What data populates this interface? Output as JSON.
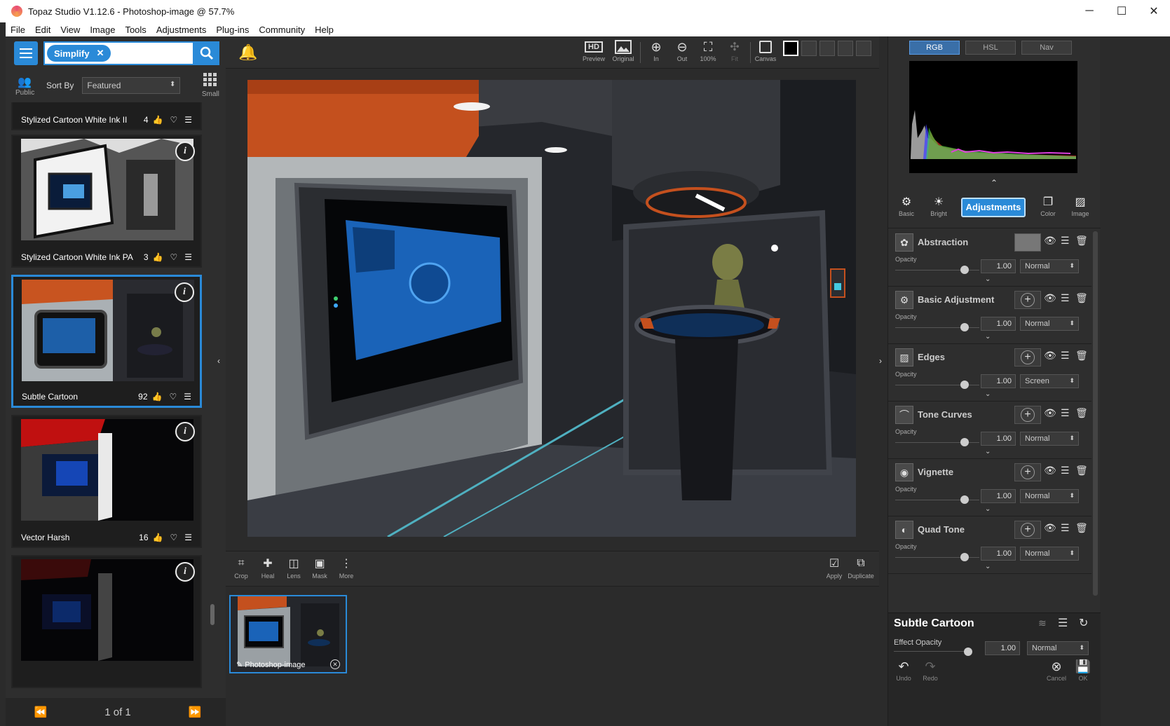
{
  "window": {
    "title": "Topaz Studio V1.12.6 - Photoshop-image @ 57.7%",
    "minimize": "─",
    "maximize": "☐",
    "close": "✕"
  },
  "menu": [
    "File",
    "Edit",
    "View",
    "Image",
    "Tools",
    "Adjustments",
    "Plug-ins",
    "Community",
    "Help"
  ],
  "left": {
    "search_chip": "Simplify",
    "public_label": "Public",
    "sort_by_label": "Sort By",
    "sort_value": "Featured",
    "small_label": "Small",
    "presets": [
      {
        "name": "Stylized Cartoon White Ink II",
        "likes": "4"
      },
      {
        "name": "Stylized Cartoon White Ink PA",
        "likes": "3"
      },
      {
        "name": "Subtle Cartoon",
        "likes": "92"
      },
      {
        "name": "Vector Harsh",
        "likes": "16"
      },
      {
        "name": "",
        "likes": ""
      }
    ],
    "pager": "1 of 1"
  },
  "toolbar": {
    "preview": "Preview",
    "original": "Original",
    "in": "In",
    "out": "Out",
    "zoom100": "100%",
    "fit": "Fit",
    "canvas": "Canvas",
    "hd": "HD"
  },
  "bottom_tools": {
    "crop": "Crop",
    "heal": "Heal",
    "lens": "Lens",
    "mask": "Mask",
    "more": "More",
    "apply": "Apply",
    "duplicate": "Duplicate"
  },
  "filmstrip": {
    "item": "Photoshop-image"
  },
  "right": {
    "tabs": [
      "RGB",
      "HSL",
      "Nav"
    ],
    "modes": {
      "basic": "Basic",
      "bright": "Bright",
      "adjustments": "Adjustments",
      "color": "Color",
      "image": "Image"
    },
    "opacity_label": "Opacity",
    "filters": [
      {
        "name": "Abstraction",
        "opacity": "1.00",
        "blend": "Normal"
      },
      {
        "name": "Basic Adjustment",
        "opacity": "1.00",
        "blend": "Normal"
      },
      {
        "name": "Edges",
        "opacity": "1.00",
        "blend": "Screen"
      },
      {
        "name": "Tone Curves",
        "opacity": "1.00",
        "blend": "Normal"
      },
      {
        "name": "Vignette",
        "opacity": "1.00",
        "blend": "Normal"
      },
      {
        "name": "Quad Tone",
        "opacity": "1.00",
        "blend": "Normal"
      }
    ],
    "preset_name": "Subtle Cartoon",
    "effect_opacity_label": "Effect Opacity",
    "effect_opacity": "1.00",
    "effect_blend": "Normal",
    "undo": "Undo",
    "redo": "Redo",
    "cancel": "Cancel",
    "ok": "OK"
  },
  "colors": {
    "accent": "#2a8ad8",
    "panel": "#2e2e2e",
    "canvas": "#2b2b2b"
  }
}
